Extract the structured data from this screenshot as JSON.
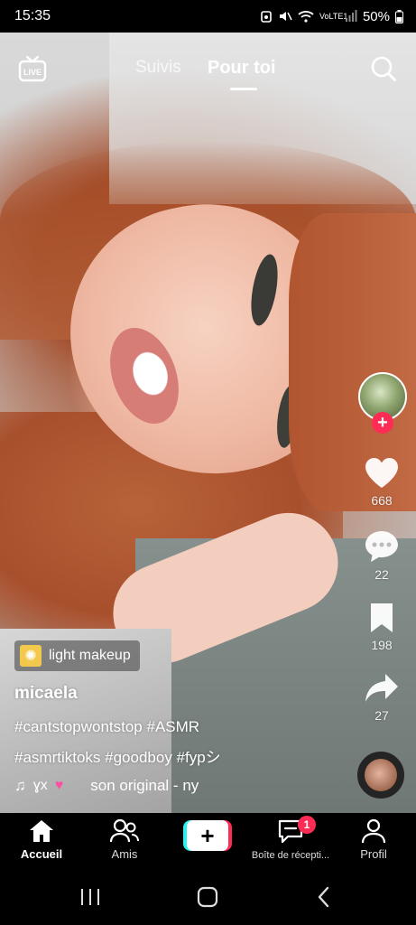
{
  "status_bar": {
    "time": "15:35",
    "battery": "50%",
    "network": "VoLTE1"
  },
  "top_nav": {
    "live_label": "LIVE",
    "tabs": [
      {
        "label": "Suivis",
        "active": false
      },
      {
        "label": "Pour toi",
        "active": true
      }
    ]
  },
  "rail": {
    "likes": "668",
    "comments": "22",
    "saves": "198",
    "shares": "27"
  },
  "video": {
    "effect_label": "light makeup",
    "username": "micaela",
    "caption_line1": "#cantstopwontstop #ASMR",
    "caption_line2": "#asmrtiktoks #goodboy #fypシ",
    "music_user": "ɣx",
    "sound_name": "son original - ny"
  },
  "tabbar": {
    "items": [
      {
        "label": "Accueil",
        "icon": "home-icon",
        "active": true
      },
      {
        "label": "Amis",
        "icon": "friends-icon",
        "active": false
      },
      {
        "label": "",
        "icon": "create-icon",
        "active": false
      },
      {
        "label": "Boîte de récepti...",
        "icon": "inbox-icon",
        "active": false
      },
      {
        "label": "Profil",
        "icon": "profile-icon",
        "active": false
      }
    ],
    "inbox_badge": "1"
  },
  "colors": {
    "accent": "#fe2c55",
    "accent_cyan": "#25f4ee"
  }
}
